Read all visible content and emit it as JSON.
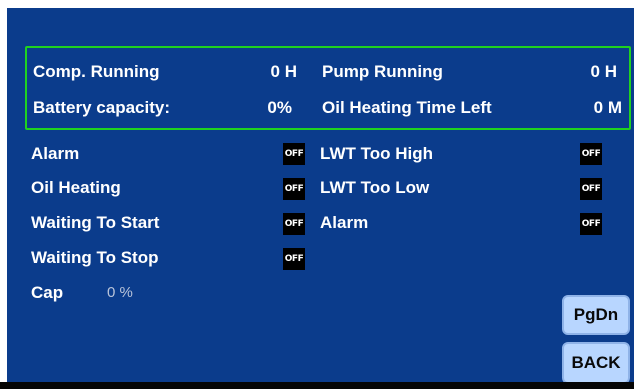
{
  "info": {
    "comp_running_label": "Comp. Running",
    "comp_running_value": "0 H",
    "pump_running_label": "Pump Running",
    "pump_running_value": "0 H",
    "battery_label": "Battery capacity:",
    "battery_value": "0%",
    "oil_time_label": "Oil Heating Time Left",
    "oil_time_value": "0 M"
  },
  "status_left": [
    {
      "label": "Alarm",
      "state": "OFF"
    },
    {
      "label": "Oil Heating",
      "state": "OFF"
    },
    {
      "label": "Waiting To Start",
      "state": "OFF"
    },
    {
      "label": "Waiting To Stop",
      "state": "OFF"
    }
  ],
  "status_right": [
    {
      "label": "LWT Too High",
      "state": "OFF"
    },
    {
      "label": "LWT Too Low",
      "state": "OFF"
    },
    {
      "label": "Alarm",
      "state": "OFF"
    }
  ],
  "cap": {
    "label": "Cap",
    "value": "0 %"
  },
  "buttons": {
    "pgdn": "PgDn",
    "back": "BACK"
  },
  "colors": {
    "background": "#0b3c8c",
    "border": "#1fd21f",
    "button": "#b8d6ff",
    "indicator": "#000000"
  }
}
